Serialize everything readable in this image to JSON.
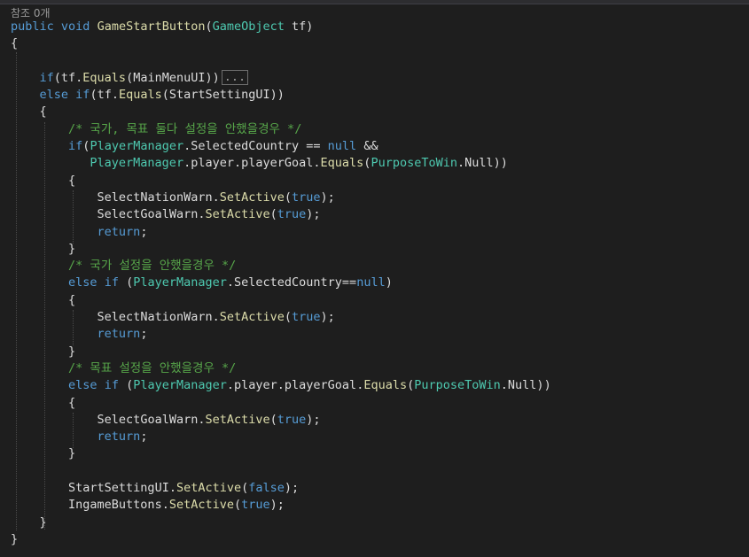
{
  "codelens": {
    "references": "참조 0개"
  },
  "colors": {
    "background": "#1e1e1e",
    "keyword": "#569cd6",
    "method": "#dcdcaa",
    "type": "#4ec9b0",
    "comment": "#57a64a",
    "text": "#dcdcdc"
  },
  "fold_label": "...",
  "code": {
    "l1": {
      "public": "public",
      "void": "void",
      "name": "GameStartButton",
      "open": "(",
      "type": "GameObject",
      "param": " tf)"
    },
    "l2": {
      "text": "{"
    },
    "l4": {
      "if": "if",
      "p1": "(tf.",
      "equals": "Equals",
      "p2": "(MainMenuUI))"
    },
    "l5": {
      "else": "else",
      "if": "if",
      "p1": "(tf.",
      "equals": "Equals",
      "p2": "(StartSettingUI))"
    },
    "l6": {
      "text": "{"
    },
    "l7": {
      "comment": "/* 국가, 목표 둘다 설정을 안했을경우 */"
    },
    "l8": {
      "if": "if",
      "p0": "(",
      "pm": "PlayerManager",
      "p1": ".SelectedCountry == ",
      "null": "null",
      "p2": " &&"
    },
    "l9": {
      "pm": "PlayerManager",
      "p1": ".player.playerGoal.",
      "equals": "Equals",
      "p2": "(",
      "ptw": "PurposeToWin",
      "p3": ".Null))"
    },
    "l10": {
      "text": "{"
    },
    "l11": {
      "obj": "SelectNationWarn.",
      "fn": "SetActive",
      "p1": "(",
      "val": "true",
      "p2": ");"
    },
    "l12": {
      "obj": "SelectGoalWarn.",
      "fn": "SetActive",
      "p1": "(",
      "val": "true",
      "p2": ");"
    },
    "l13": {
      "ret": "return",
      "p": ";"
    },
    "l14": {
      "text": "}"
    },
    "l15": {
      "comment": "/* 국가 설정을 안했을경우 */"
    },
    "l16": {
      "else": "else",
      "if": "if",
      "p0": " (",
      "pm": "PlayerManager",
      "p1": ".SelectedCountry==",
      "null": "null",
      "p2": ")"
    },
    "l17": {
      "text": "{"
    },
    "l18": {
      "obj": "SelectNationWarn.",
      "fn": "SetActive",
      "p1": "(",
      "val": "true",
      "p2": ");"
    },
    "l19": {
      "ret": "return",
      "p": ";"
    },
    "l20": {
      "text": "}"
    },
    "l21": {
      "comment": "/* 목표 설정을 안했을경우 */"
    },
    "l22": {
      "else": "else",
      "if": "if",
      "p0": " (",
      "pm": "PlayerManager",
      "p1": ".player.playerGoal.",
      "equals": "Equals",
      "p2": "(",
      "ptw": "PurposeToWin",
      "p3": ".Null))"
    },
    "l23": {
      "text": "{"
    },
    "l24": {
      "obj": "SelectGoalWarn.",
      "fn": "SetActive",
      "p1": "(",
      "val": "true",
      "p2": ");"
    },
    "l25": {
      "ret": "return",
      "p": ";"
    },
    "l26": {
      "text": "}"
    },
    "l28": {
      "obj": "StartSettingUI.",
      "fn": "SetActive",
      "p1": "(",
      "val": "false",
      "p2": ");"
    },
    "l29": {
      "obj": "IngameButtons.",
      "fn": "SetActive",
      "p1": "(",
      "val": "true",
      "p2": ");"
    },
    "l30": {
      "text": "}"
    },
    "l31": {
      "text": "}"
    }
  }
}
